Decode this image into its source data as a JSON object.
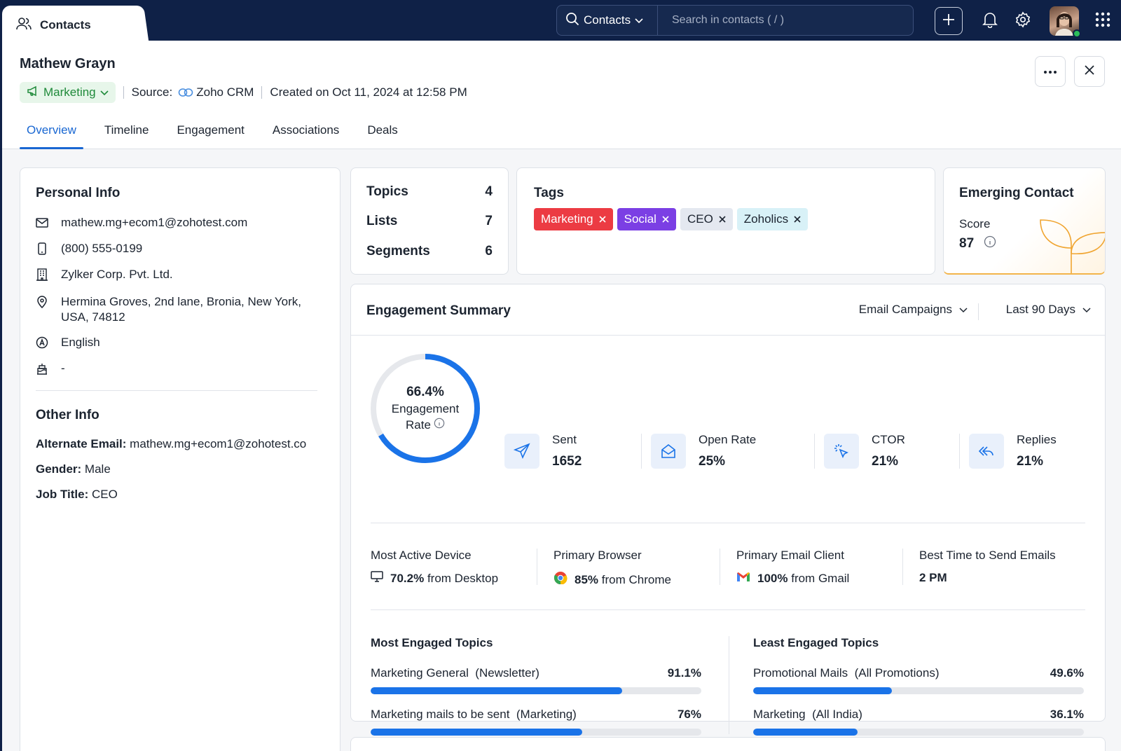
{
  "topbar": {
    "tab_label": "Contacts",
    "search_scope": "Contacts",
    "search_placeholder": "Search in contacts ( / )"
  },
  "contact": {
    "name": "Mathew Grayn",
    "list_label": "Marketing",
    "source_label": "Source:",
    "source_value": "Zoho CRM",
    "created": "Created on Oct 11, 2024 at 12:58 PM"
  },
  "tabs": [
    "Overview",
    "Timeline",
    "Engagement",
    "Associations",
    "Deals"
  ],
  "personal_info": {
    "title": "Personal Info",
    "email": "mathew.mg+ecom1@zohotest.com",
    "phone": "(800) 555-0199",
    "company": "Zylker Corp. Pvt. Ltd.",
    "address_line1": "Hermina Groves, 2nd lane, Bronia, New York,",
    "address_line2": "USA, 74812",
    "language": "English",
    "birthday": "-"
  },
  "other_info": {
    "title": "Other Info",
    "alt_email_label": "Alternate Email:",
    "alt_email_value": "mathew.mg+ecom1@zohotest.co",
    "gender_label": "Gender:",
    "gender_value": "Male",
    "job_label": "Job Title:",
    "job_value": "CEO"
  },
  "counts": [
    {
      "label": "Topics",
      "value": "4"
    },
    {
      "label": "Lists",
      "value": "7"
    },
    {
      "label": "Segments",
      "value": "6"
    }
  ],
  "tags": {
    "title": "Tags",
    "items": [
      {
        "label": "Marketing",
        "bg": "#ec3b43",
        "fg": "#ffffff"
      },
      {
        "label": "Social",
        "bg": "#7b3fe4",
        "fg": "#ffffff"
      },
      {
        "label": "CEO",
        "bg": "#e4e8f0",
        "fg": "#1c2430"
      },
      {
        "label": "Zoholics",
        "bg": "#d8f1f7",
        "fg": "#1c2430"
      }
    ]
  },
  "emerging": {
    "title": "Emerging Contact",
    "score_label": "Score",
    "score_value": "87"
  },
  "engagement": {
    "title": "Engagement Summary",
    "filter_campaign": "Email Campaigns",
    "filter_period": "Last 90 Days",
    "rate_value": "66.4%",
    "rate_fraction": 0.664,
    "rate_label_1": "Engagement",
    "rate_label_2": "Rate",
    "stats": [
      {
        "label": "Sent",
        "value": "1652",
        "icon": "send-icon"
      },
      {
        "label": "Open Rate",
        "value": "25%",
        "icon": "open-mail-icon"
      },
      {
        "label": "CTOR",
        "value": "21%",
        "icon": "click-icon"
      },
      {
        "label": "Replies",
        "value": "21%",
        "icon": "reply-all-icon"
      }
    ],
    "device": {
      "label": "Most Active Device",
      "value_bold": "70.2%",
      "value_rest": "from Desktop"
    },
    "browser": {
      "label": "Primary Browser",
      "value_bold": "85%",
      "value_rest": "from Chrome"
    },
    "client": {
      "label": "Primary Email Client",
      "value_bold": "100%",
      "value_rest": "from Gmail"
    },
    "best_time": {
      "label": "Best Time to Send Emails",
      "value": "2 PM"
    },
    "most_title": "Most Engaged Topics",
    "least_title": "Least Engaged Topics",
    "most": [
      {
        "name": "Marketing General",
        "group": "(Newsletter)",
        "pct": "91.1%",
        "frac": 0.76
      },
      {
        "name": "Marketing mails to be sent",
        "group": "(Marketing)",
        "pct": "76%",
        "frac": 0.64
      }
    ],
    "least": [
      {
        "name": "Promotional Mails",
        "group": "(All Promotions)",
        "pct": "49.6%",
        "frac": 0.42
      },
      {
        "name": "Marketing",
        "group": "(All India)",
        "pct": "36.1%",
        "frac": 0.315
      }
    ]
  },
  "colors": {
    "nav_bg": "#0f2147",
    "accent": "#1967d2",
    "progress": "#1a73e8",
    "marketing_pill_bg": "#e7f6ea",
    "marketing_pill_fg": "#1f8a3a"
  }
}
